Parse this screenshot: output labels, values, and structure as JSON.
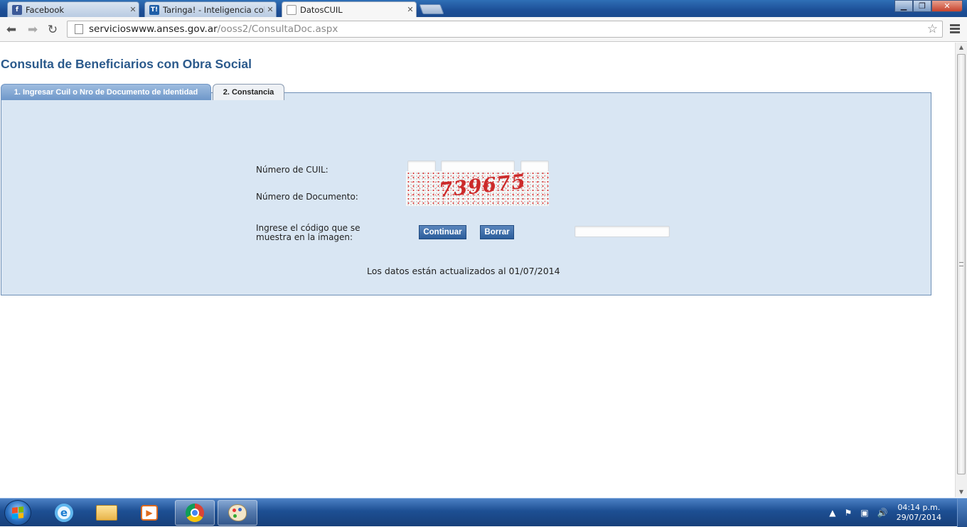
{
  "browser": {
    "tabs": [
      {
        "title": "Facebook",
        "favicon": "facebook-icon",
        "favicon_letter": "f",
        "color": "#3b5998"
      },
      {
        "title": "Taringa! - Inteligencia colectiva",
        "favicon": "taringa-icon",
        "favicon_letter": "T!",
        "color": "#1e5ea8"
      },
      {
        "title": "DatosCUIL",
        "favicon": "page-icon",
        "favicon_letter": "",
        "color": "#ffffff"
      }
    ],
    "url_host": "servicioswww.anses.gov.ar",
    "url_path": "/ooss2/ConsultaDoc.aspx"
  },
  "page": {
    "title": "Consulta de Beneficiarios con Obra Social",
    "tabs": [
      {
        "label": "1. Ingresar Cuil o Nro de Documento de Identidad"
      },
      {
        "label": "2. Constancia"
      }
    ],
    "form": {
      "cuil_label": "Número de CUIL:",
      "documento_label": "Número de Documento:",
      "captcha_label_line1": "Ingrese el código que se",
      "captcha_label_line2": "muestra en la imagen:",
      "captcha_code": "739675",
      "continuar_label": "Continuar",
      "borrar_label": "Borrar"
    },
    "footnote": "Los datos están actualizados al 01/07/2014"
  },
  "taskbar": {
    "time": "04:14 p.m.",
    "date": "29/07/2014"
  },
  "colors": {
    "panel_bg": "#d9e6f3",
    "title": "#2b5a8c",
    "button": "#2b5d9b"
  }
}
